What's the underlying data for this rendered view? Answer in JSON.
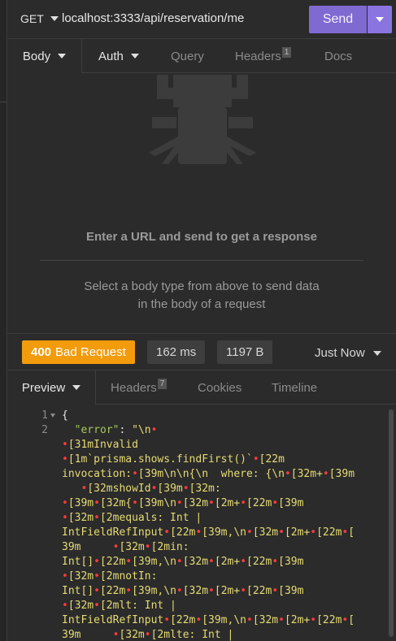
{
  "request": {
    "method": "GET",
    "url": "localhost:3333/api/reservation/me",
    "send_label": "Send"
  },
  "request_tabs": {
    "body": "Body",
    "auth": "Auth",
    "query": "Query",
    "headers": "Headers",
    "headers_count": "1",
    "docs": "Docs"
  },
  "empty_state": {
    "title": "Enter a URL and send to get a response",
    "desc_line1": "Select a body type from above to send data",
    "desc_line2": "in the body of a request"
  },
  "response": {
    "status_code": "400",
    "status_text": "Bad Request",
    "time": "162 ms",
    "size": "1197 B",
    "history": "Just Now"
  },
  "response_tabs": {
    "preview": "Preview",
    "headers": "Headers",
    "headers_count": "7",
    "cookies": "Cookies",
    "timeline": "Timeline"
  },
  "code": {
    "line_numbers": [
      "1",
      "2"
    ],
    "open_brace": "{",
    "error_key": "\"error\"",
    "colon": ": ",
    "value_start": "\"\\n",
    "segments": [
      "[31mInvalid",
      "[1m`prisma.shows.findFirst()`",
      "[22m",
      "invocation:",
      "[39m\\n\\n{\\n  where: {\\n",
      "[32m+",
      "[39m",
      "[32mshowId",
      "[39m",
      "[32m:",
      "[39m",
      "[32m{",
      "[39m\\n",
      "[32m",
      "[2m+",
      "[22m",
      "[39m",
      "[32m",
      "[2mequals: Int |",
      "IntFieldRefInput",
      "[22m",
      "[39m,\\n",
      "[32m",
      "[2m+",
      "[22m",
      "[",
      "39m",
      "[32m",
      "[2min:",
      "Int[]",
      "[22m",
      "[39m,\\n",
      "[32m",
      "[2m+",
      "[22m",
      "[39m",
      "[32m",
      "[2mnotIn:",
      "Int[]",
      "[22m",
      "[39m,\\n",
      "[32m",
      "[2m+",
      "[22m",
      "[39m",
      "[32m",
      "[2mlt: Int |",
      "IntFieldRefInput",
      "[22m",
      "[39m,\\n",
      "[32m",
      "[2m+",
      "[22m",
      "[",
      "39m",
      "[32m",
      "[2mlte: Int |"
    ]
  }
}
